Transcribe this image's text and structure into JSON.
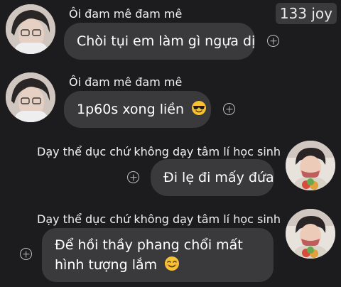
{
  "header": {
    "counter": "133 joy"
  },
  "messages": [
    {
      "sender": "Ôi đam mê đam mê",
      "text": "Chòi tụi em làm gì ngựa dị",
      "emoji": ""
    },
    {
      "sender": "Ôi đam mê đam mê",
      "text": "1p60s xong liền",
      "emoji": "sunglasses-emoji"
    },
    {
      "sender": "Dạy thể dục chứ không dạy tâm lí học sinh",
      "text": "Đi lẹ đi mấy đứa",
      "emoji": ""
    },
    {
      "sender": "Dạy thể dục chứ không dạy tâm lí học sinh",
      "text": "Để hồi thầy phang chổi mất hình tượng lắm",
      "emoji": "smiling-emoji"
    }
  ],
  "colors": {
    "background": "#1c1c1e",
    "bubble": "#3a3a3c",
    "text": "#ffffff",
    "add_reaction_icon": "#bdbdbd"
  }
}
